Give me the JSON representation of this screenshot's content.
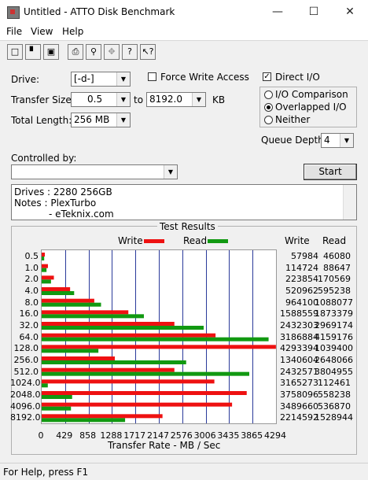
{
  "window": {
    "title": "Untitled - ATTO Disk Benchmark"
  },
  "menu": [
    "File",
    "View",
    "Help"
  ],
  "toolbar": {
    "icons": [
      "new-icon",
      "open-icon",
      "save-icon",
      "print-icon",
      "print-preview-icon",
      "move-icon",
      "help-icon",
      "context-help-icon"
    ]
  },
  "drive": {
    "label": "Drive:",
    "value": "[-d-]"
  },
  "force_write": {
    "label": "Force Write Access",
    "checked": false
  },
  "direct_io": {
    "label": "Direct I/O",
    "checked": true
  },
  "transfer": {
    "label": "Transfer Size:",
    "from": "0.5",
    "to_label": "to",
    "to": "8192.0",
    "unit": "KB"
  },
  "total_length": {
    "label": "Total Length:",
    "value": "256 MB"
  },
  "io_mode": {
    "options": [
      "I/O Comparison",
      "Overlapped I/O",
      "Neither"
    ],
    "selected": "Overlapped I/O"
  },
  "queue_depth": {
    "label": "Queue Depth:",
    "value": "4"
  },
  "controlled_by": {
    "label": "Controlled by:",
    "value": ""
  },
  "start_button": "Start",
  "notes": {
    "line1": "Drives :  2280 256GB",
    "line2": "Notes : PlexTurbo",
    "line3": "- eTeknix.com"
  },
  "results": {
    "title": "Test Results",
    "legend_write": "Write",
    "legend_read": "Read",
    "col_write": "Write",
    "col_read": "Read",
    "xlabel": "Transfer Rate - MB / Sec"
  },
  "chart_data": {
    "type": "bar",
    "orientation": "horizontal",
    "categories": [
      "0.5",
      "1.0",
      "2.0",
      "4.0",
      "8.0",
      "16.0",
      "32.0",
      "64.0",
      "128.0",
      "256.0",
      "512.0",
      "1024.0",
      "2048.0",
      "4096.0",
      "8192.0"
    ],
    "series": [
      {
        "name": "Write",
        "color": "#ee1111",
        "values": [
          57984,
          114724,
          223854,
          520962,
          964100,
          1588559,
          2432303,
          3186884,
          4293394,
          1340604,
          2432571,
          3165273,
          3758096,
          3489660,
          2214592
        ]
      },
      {
        "name": "Read",
        "color": "#119911",
        "values": [
          46080,
          88647,
          170569,
          595238,
          1088077,
          1873379,
          2969174,
          4159176,
          1039400,
          2648066,
          3804955,
          112461,
          558238,
          536870,
          1528944
        ]
      }
    ],
    "xticks": [
      "0",
      "429",
      "858",
      "1288",
      "1717",
      "2147",
      "2576",
      "3006",
      "3435",
      "3865",
      "4294"
    ],
    "xlim": [
      0,
      4294967
    ],
    "xlabel": "Transfer Rate - MB / Sec",
    "write_text": [
      "57984",
      "114724",
      "223854",
      "520962",
      "964100",
      "1588559",
      "2432303",
      "3186884",
      "4293394",
      "1340604",
      "2432571",
      "3165273",
      "3758096",
      "3489660",
      "2214592"
    ],
    "read_text": [
      "46080",
      "88647",
      "170569",
      "595238",
      "1088077",
      "1873379",
      "2969174",
      "4159176",
      "1039400",
      "2648066",
      "3804955",
      "112461",
      "558238",
      "536870",
      "1528944"
    ]
  },
  "status": "For Help, press F1"
}
